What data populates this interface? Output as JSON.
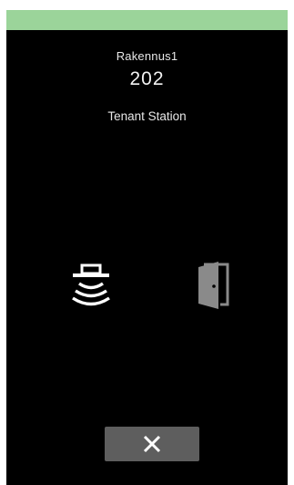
{
  "status_bar": {
    "color": "#9bd49a"
  },
  "caller": {
    "building": "Rakennus1",
    "unit_number": "202",
    "station_type": "Tenant Station"
  },
  "controls": {
    "speaker_icon": "speaker-talk-icon",
    "door_icon": "door-open-icon",
    "close_icon": "close-x-icon"
  }
}
